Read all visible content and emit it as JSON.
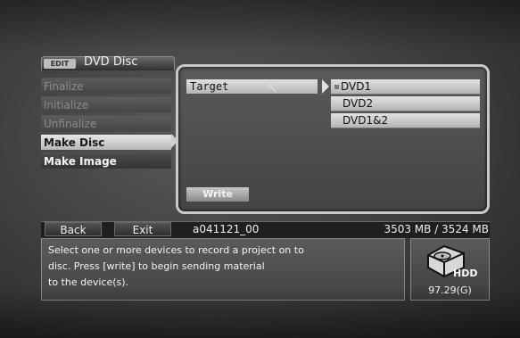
{
  "header": {
    "edit_badge": "EDIT",
    "title": "DVD Disc"
  },
  "menu": {
    "items": [
      {
        "label": "Finalize",
        "state": "disabled"
      },
      {
        "label": "Initialize",
        "state": "disabled"
      },
      {
        "label": "Unfinalize",
        "state": "disabled"
      },
      {
        "label": "Make Disc",
        "state": "selected"
      },
      {
        "label": "Make Image",
        "state": "normal"
      }
    ]
  },
  "panel": {
    "target_label": "Target",
    "devices": [
      "DVD1",
      "DVD2",
      "DVD1&2"
    ],
    "write_label": "Write"
  },
  "status_bar": {
    "back_label": "Back",
    "exit_label": "Exit",
    "project_name": "a041121_00",
    "size_text": "3503 MB / 3524 MB"
  },
  "message": {
    "text": "Select one or more devices to record a project on to\ndisc. Press [write] to begin sending material\nto the device(s)."
  },
  "hdd": {
    "label": "HDD",
    "size": "97.29(G)"
  },
  "icons": [
    "cursor-icon",
    "checkbox-icon",
    "hdd-icon",
    "arrow-right-icon"
  ]
}
